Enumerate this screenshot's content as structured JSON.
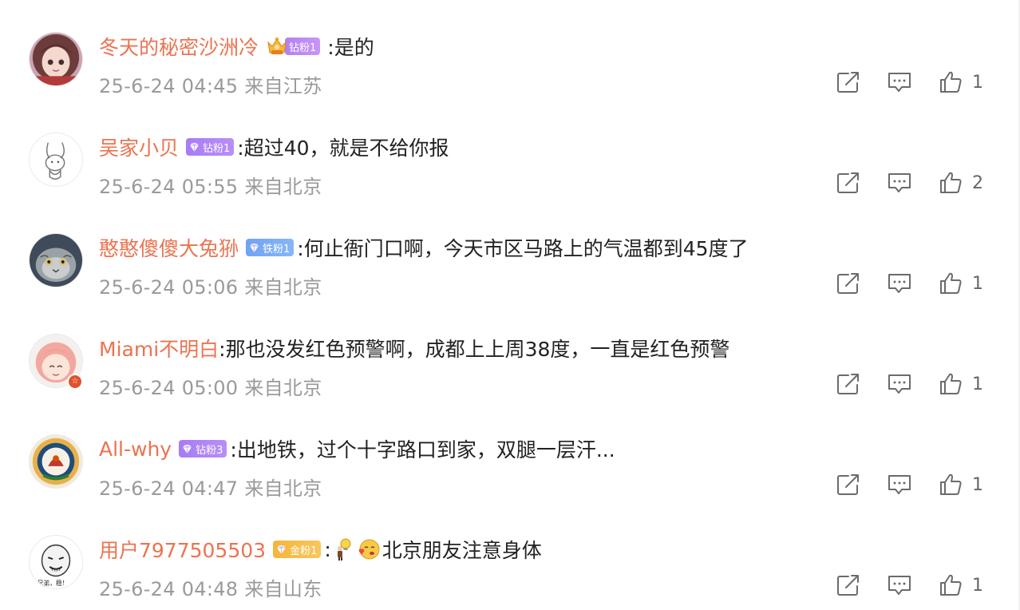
{
  "comments": [
    {
      "username": "冬天的秘密沙洲冷",
      "badge": "钻粉1",
      "badge_style": "crown",
      "text": ":是的",
      "emojis": [],
      "date": "25-6-24 04:45",
      "location": "来自江苏",
      "likes": "1",
      "avatar": "anime-girl-avatar"
    },
    {
      "username": "吴家小贝",
      "badge": "钻粉1",
      "badge_style": "purple",
      "text": ":超过40，就是不给你报",
      "emojis": [],
      "date": "25-6-24 05:55",
      "location": "来自北京",
      "likes": "2",
      "avatar": "rabbit-sketch-avatar"
    },
    {
      "username": "憨憨傻傻大兔狲",
      "badge": "铁粉1",
      "badge_style": "blue",
      "text": ":何止衙门口啊，今天市区马路上的气温都到45度了",
      "emojis": [],
      "date": "25-6-24 05:06",
      "location": "来自北京",
      "likes": "1",
      "avatar": "pallas-cat-avatar"
    },
    {
      "username": "Miami不明白",
      "badge": "",
      "badge_style": "none",
      "text": ":那也没发红色预警啊，成都上上周38度，一直是红色预警",
      "emojis": [],
      "date": "25-6-24 05:00",
      "location": "来自北京",
      "likes": "1",
      "avatar": "cartoon-girl-avatar"
    },
    {
      "username": "All-why",
      "badge": "钻粉3",
      "badge_style": "purple",
      "text": ":出地铁，过个十字路口到家，双腿一层汗...",
      "emojis": [],
      "date": "25-6-24 04:47",
      "location": "来自北京",
      "likes": "1",
      "avatar": "emblem-avatar"
    },
    {
      "username": "用户7977505503",
      "badge": "金粉1",
      "badge_style": "gold",
      "text": "北京朋友注意身体",
      "prefix": ":",
      "emojis": [
        "light-bulb-man-emoji",
        "heart-face-emoji"
      ],
      "date": "25-6-24 04:48",
      "location": "来自山东",
      "likes": "1",
      "avatar": "meme-face-avatar"
    }
  ],
  "icons": {
    "share": "share-icon",
    "reply": "comment-icon",
    "like": "thumbs-up-icon"
  },
  "colors": {
    "username": "#eb7350",
    "meta": "#9a9a9a",
    "text": "#222222",
    "icon": "#6b6b6b"
  }
}
